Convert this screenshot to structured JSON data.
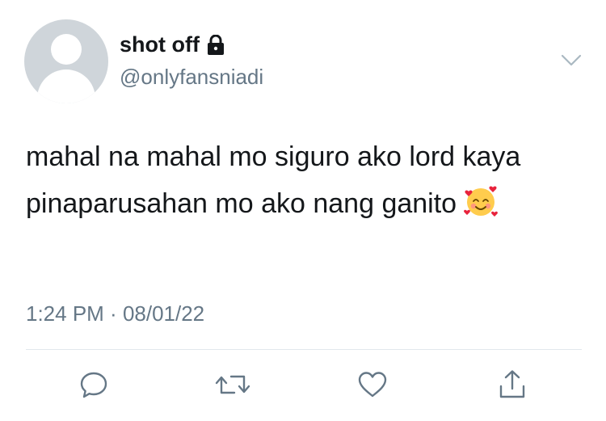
{
  "user": {
    "display_name": "shot off",
    "handle": "@onlyfansniadi",
    "protected_icon": "lock-icon",
    "avatar_icon": "default-avatar"
  },
  "tweet": {
    "text": "mahal na mahal mo siguro ako lord kaya pinaparusahan mo ako nang ganito",
    "emoji": "smiling-face-with-hearts"
  },
  "meta": {
    "time": "1:24 PM",
    "separator": " · ",
    "date": "08/01/22"
  },
  "menu_icon": "chevron-down-icon",
  "actions": [
    "reply-icon",
    "retweet-icon",
    "like-icon",
    "share-icon"
  ],
  "colors": {
    "text": "#14171a",
    "secondary": "#657786",
    "avatar": "#cfd5da"
  }
}
